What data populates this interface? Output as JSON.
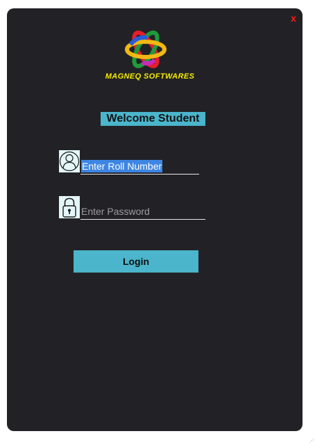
{
  "window": {
    "close_label": "x",
    "brand": "MAGNEQ SOFTWARES",
    "welcome": "Welcome Student",
    "roll_placeholder": "Enter Roll Number",
    "password_placeholder": "Enter Password",
    "login_label": "Login"
  },
  "colors": {
    "background": "#222226",
    "accent": "#4bb5cb",
    "brand_text": "#f4ea00",
    "close": "#ff1a1a",
    "selection": "#3d86e3"
  },
  "icons": {
    "logo": "magneq-logo-icon",
    "user": "user-icon",
    "lock": "lock-icon"
  }
}
